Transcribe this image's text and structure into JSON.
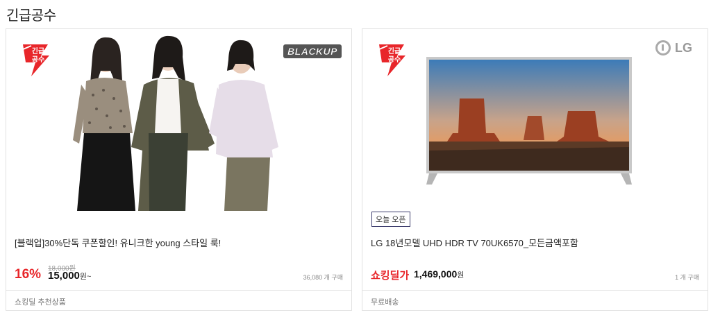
{
  "section": {
    "title": "긴급공수"
  },
  "badge": {
    "text_line1": "긴급",
    "text_line2": "공수",
    "color": "#e8262a"
  },
  "cards": [
    {
      "brand": "BLACKUP",
      "title": "[블랙업]30%단독 쿠폰할인! 유니크한 young 스타일 룩!",
      "discount": "16%",
      "original_price": "18,000원",
      "price": "15,000",
      "price_unit": "원~",
      "buy_count": "36,080 개 구매",
      "footer": "쇼킹딜 추천상품"
    },
    {
      "brand": "LG",
      "tag": "오늘 오픈",
      "title": "LG 18년모델 UHD HDR TV 70UK6570_모든금액포함",
      "deal_label": "쇼킹딜가",
      "price": "1,469,000",
      "price_unit": "원",
      "buy_count": "1 개 구매",
      "footer": "무료배송"
    }
  ]
}
